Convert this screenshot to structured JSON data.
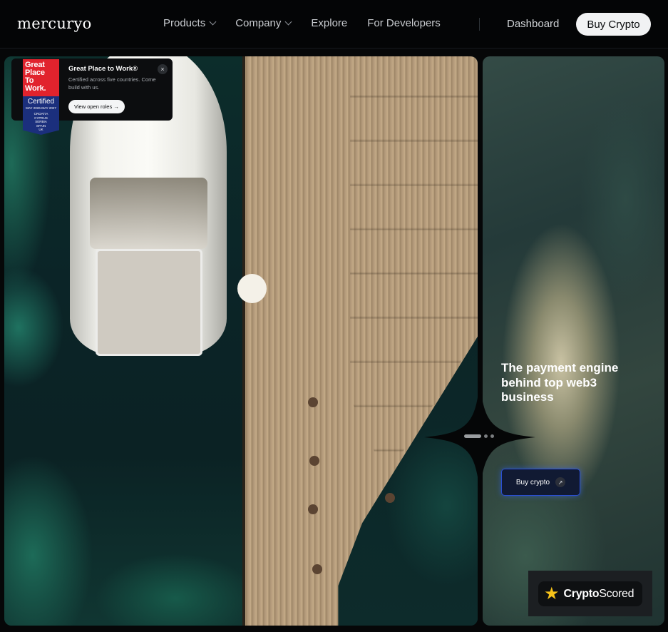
{
  "nav": {
    "logo": "mercuryo",
    "links": [
      {
        "label": "Products",
        "has_dropdown": true
      },
      {
        "label": "Company",
        "has_dropdown": true
      },
      {
        "label": "Explore",
        "has_dropdown": false
      },
      {
        "label": "For Developers",
        "has_dropdown": false
      }
    ],
    "dashboard": "Dashboard",
    "buy_button": "Buy Crypto"
  },
  "gptw_card": {
    "badge_lines": [
      "Great",
      "Place",
      "To",
      "Work."
    ],
    "badge_certified": "Certified",
    "badge_dates": "MAY 2026-MAY 2027",
    "badge_countries": [
      "CROATIA",
      "CYPRUS",
      "SERBIA",
      "SPAIN",
      "UK"
    ],
    "title": "Great Place to Work®",
    "description": "Certified across five countries. Come build with us.",
    "button": "View open roles →",
    "close_icon": "×"
  },
  "hero": {
    "headline": "The payment engine behind top web3 business",
    "cta": "Buy crypto",
    "cta_icon": "↗",
    "carousel": {
      "total": 3,
      "active": 1
    }
  },
  "rating_badge": {
    "star": "★",
    "brand_bold": "Crypto",
    "brand_regular": "Scored"
  },
  "colors": {
    "background": "#060708",
    "accent_blue": "#2a4fd6",
    "badge_red": "#e1232d",
    "badge_blue": "#1b2f7d",
    "star_yellow": "#f6c21a"
  }
}
